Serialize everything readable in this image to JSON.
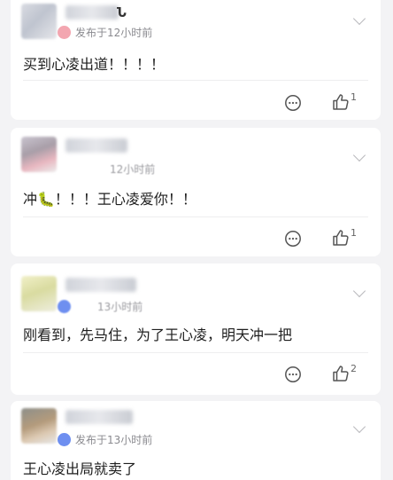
{
  "comments": [
    {
      "name_suffix": "Ն",
      "time": "发布于12小时前",
      "text": "买到心凌出道！！！！",
      "likes": "1"
    },
    {
      "name_suffix": "",
      "time": "12小时前",
      "text": "冲🐛！！！王心凌爱你！！",
      "likes": "1"
    },
    {
      "name_suffix": "",
      "time": "13小时前",
      "text": "刚看到，先马住，为了王心凌，明天冲一把",
      "likes": "2"
    },
    {
      "name_suffix": "",
      "time": "发布于13小时前",
      "text": "王心凌出局就卖了",
      "likes": ""
    }
  ],
  "icons": {
    "comment": "comment-icon",
    "like": "thumbs-up-icon",
    "more": "chevron-down-icon"
  },
  "colors": {
    "background": "#f3f3f5",
    "card": "#ffffff",
    "meta_text": "#8a8a8f",
    "icon": "#555555"
  }
}
